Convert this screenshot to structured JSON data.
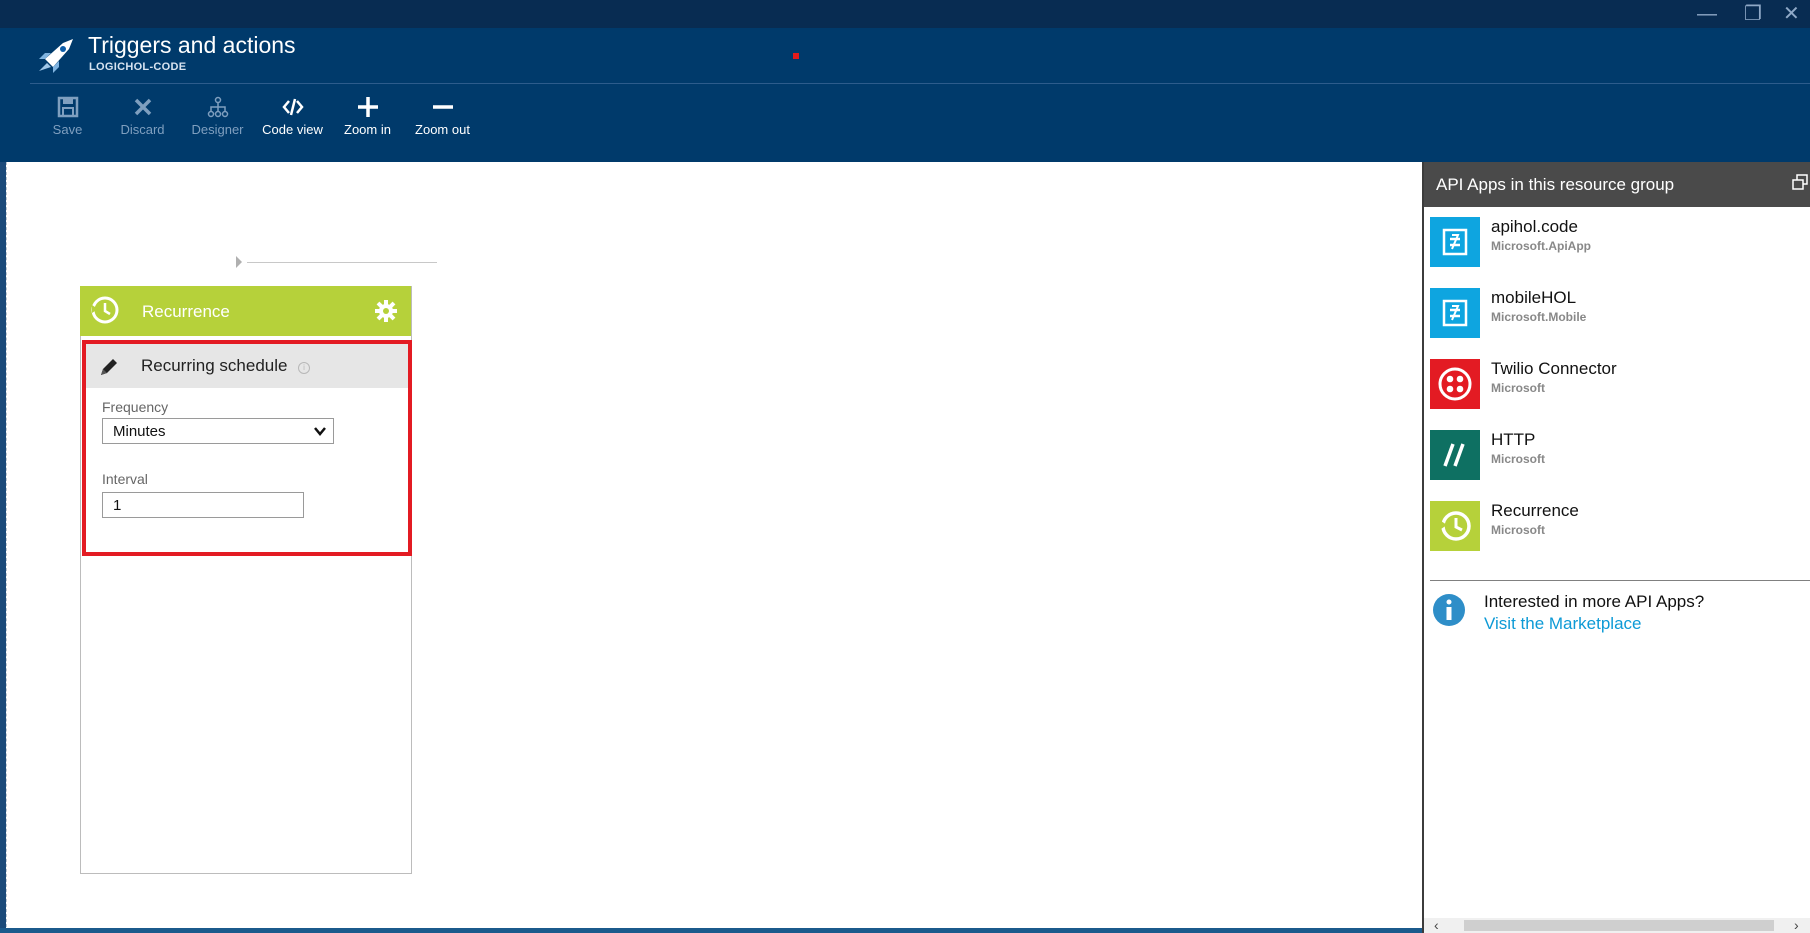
{
  "window": {
    "title": "Triggers and actions",
    "subtitle": "LOGICHOL-CODE",
    "controls": {
      "minimize": "—",
      "restore": "❐",
      "close": "✕"
    }
  },
  "toolbar": {
    "items": [
      {
        "label": "Save",
        "icon": "save-icon",
        "enabled": false
      },
      {
        "label": "Discard",
        "icon": "discard-icon",
        "enabled": false
      },
      {
        "label": "Designer",
        "icon": "designer-icon",
        "enabled": false
      },
      {
        "label": "Code view",
        "icon": "code-icon",
        "enabled": true
      },
      {
        "label": "Zoom in",
        "icon": "plus-icon",
        "enabled": true
      },
      {
        "label": "Zoom out",
        "icon": "minus-icon",
        "enabled": true
      }
    ]
  },
  "designer": {
    "card": {
      "title": "Recurrence",
      "accent_color": "#b6d13a",
      "section_title": "Recurring schedule",
      "info_glyph": "i",
      "frequency_label": "Frequency",
      "frequency_value": "Minutes",
      "interval_label": "Interval",
      "interval_value": "1",
      "highlight_color": "#e31b23"
    }
  },
  "panel": {
    "title": "API Apps in this resource group",
    "apps": [
      {
        "name": "apihol.code",
        "publisher": "Microsoft.ApiApp",
        "icon": "api-app-icon",
        "color": "#0ea5e0"
      },
      {
        "name": "mobileHOL",
        "publisher": "Microsoft.Mobile",
        "icon": "mobile-app-icon",
        "color": "#0ea5e0"
      },
      {
        "name": "Twilio Connector",
        "publisher": "Microsoft",
        "icon": "twilio-icon",
        "color": "#e31b23"
      },
      {
        "name": "HTTP",
        "publisher": "Microsoft",
        "icon": "http-icon",
        "color": "#0e7062"
      },
      {
        "name": "Recurrence",
        "publisher": "Microsoft",
        "icon": "recurrence-icon",
        "color": "#b6d13a"
      }
    ],
    "more_text": "Interested in more API Apps?",
    "more_link": "Visit the Marketplace",
    "scroll_left": "‹",
    "scroll_right": "›"
  },
  "colors": {
    "header_bg": "#003a6b",
    "panel_head_bg": "#4a4a4a",
    "link": "#0d9ad6"
  }
}
